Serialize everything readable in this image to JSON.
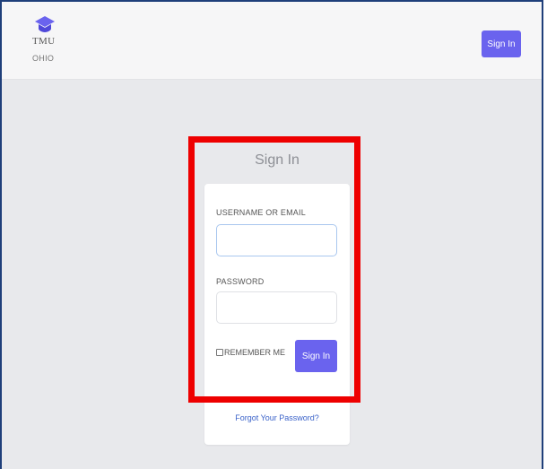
{
  "header": {
    "logo_name": "TMU",
    "logo_sub": "OHIO",
    "logo_icon": "graduation-cap-icon",
    "signin_label": "Sign In"
  },
  "signin_form": {
    "title": "Sign In",
    "username_label": "USERNAME OR EMAIL",
    "username_value": "",
    "password_label": "PASSWORD",
    "password_value": "",
    "remember_label": "REMEMBER ME",
    "remember_checked": false,
    "submit_label": "Sign In",
    "forgot_label": "Forgot Your Password?"
  },
  "colors": {
    "accent": "#6a63ee",
    "highlight_border": "#ee0000",
    "link": "#3a62c9",
    "background": "#e8e9ec"
  }
}
